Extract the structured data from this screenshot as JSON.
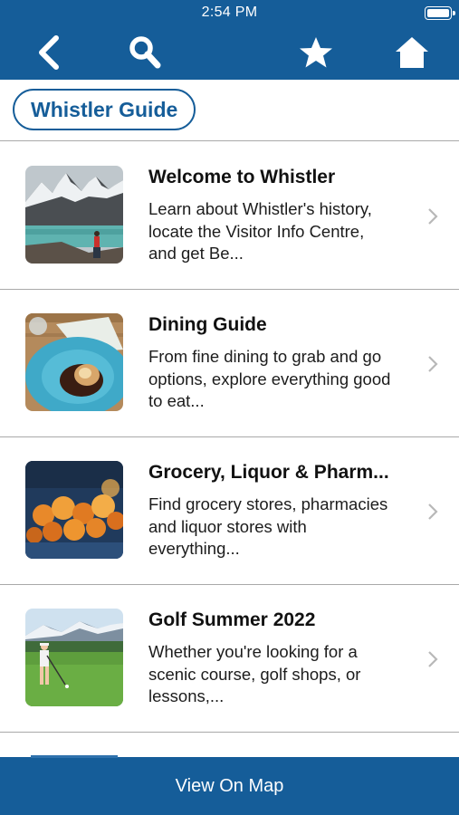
{
  "status_bar": {
    "time": "2:54 PM"
  },
  "header": {
    "icons": {
      "back": "back-arrow-icon",
      "search": "search-icon",
      "favorite": "star-icon",
      "home": "home-icon"
    },
    "color": "#155d99"
  },
  "title": {
    "label": "Whistler Guide"
  },
  "items": [
    {
      "title": "Welcome to Whistler",
      "description": "Learn about Whistler's history, locate the Visitor Info Centre, and get Be...",
      "image": "mountain-lake-hiker"
    },
    {
      "title": "Dining Guide",
      "description": "From fine dining to grab and go options, explore everything good to eat...",
      "image": "plated-dish"
    },
    {
      "title": "Grocery, Liquor & Pharm...",
      "description": "Find grocery stores, pharmacies and liquor stores with everything...",
      "image": "produce-oranges"
    },
    {
      "title": "Golf Summer 2022",
      "description": "Whether you're looking for a scenic course, golf shops, or lessons,...",
      "image": "golfer-on-course"
    }
  ],
  "bottom_bar": {
    "label": "View On Map"
  }
}
